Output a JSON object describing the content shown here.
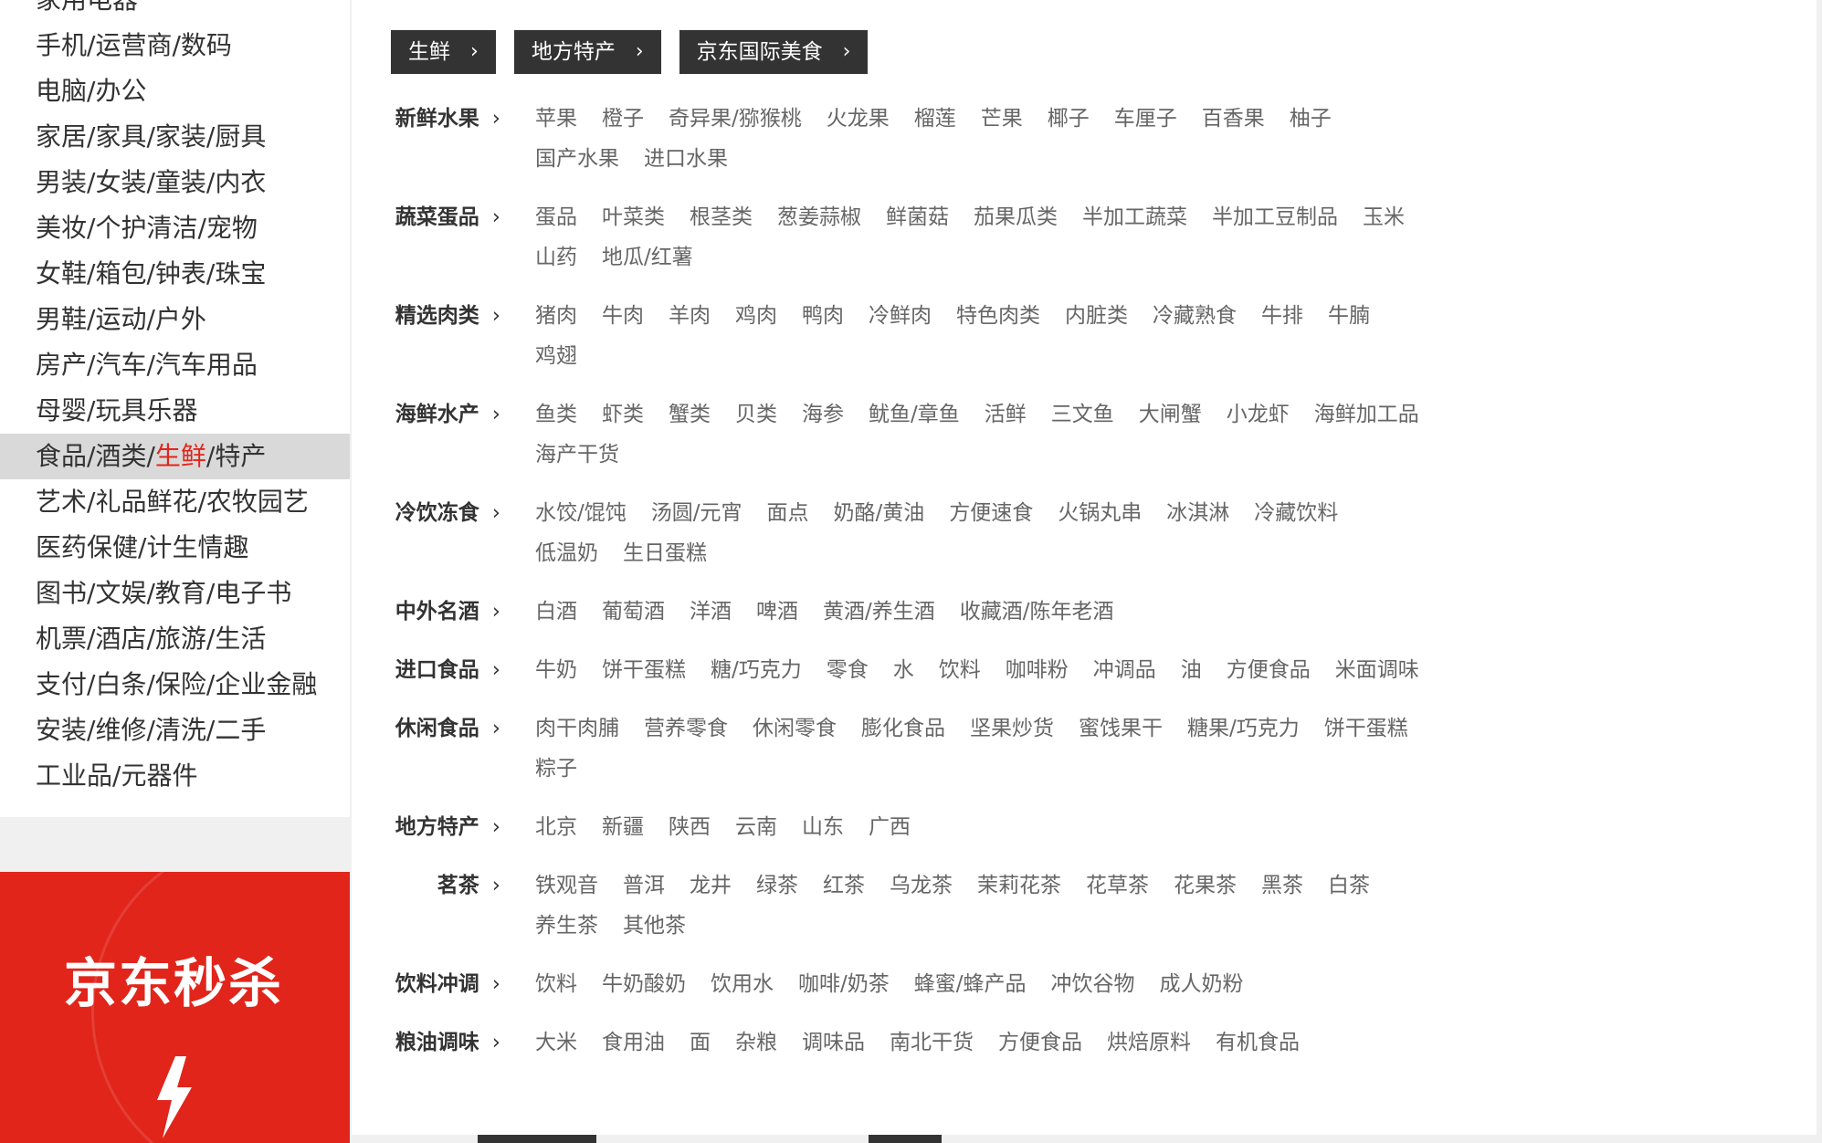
{
  "sidebar": {
    "items": [
      {
        "parts": [
          "家用电器"
        ]
      },
      {
        "parts": [
          "手机",
          "运营商",
          "数码"
        ]
      },
      {
        "parts": [
          "电脑",
          "办公"
        ]
      },
      {
        "parts": [
          "家居",
          "家具",
          "家装",
          "厨具"
        ]
      },
      {
        "parts": [
          "男装",
          "女装",
          "童装",
          "内衣"
        ]
      },
      {
        "parts": [
          "美妆",
          "个护清洁",
          "宠物"
        ]
      },
      {
        "parts": [
          "女鞋",
          "箱包",
          "钟表",
          "珠宝"
        ]
      },
      {
        "parts": [
          "男鞋",
          "运动",
          "户外"
        ]
      },
      {
        "parts": [
          "房产",
          "汽车",
          "汽车用品"
        ]
      },
      {
        "parts": [
          "母婴",
          "玩具乐器"
        ]
      },
      {
        "parts": [
          "食品",
          "酒类",
          "生鲜",
          "特产"
        ],
        "active": true,
        "highlight": 2
      },
      {
        "parts": [
          "艺术",
          "礼品鲜花",
          "农牧园艺"
        ]
      },
      {
        "parts": [
          "医药保健",
          "计生情趣"
        ]
      },
      {
        "parts": [
          "图书",
          "文娱",
          "教育",
          "电子书"
        ]
      },
      {
        "parts": [
          "机票",
          "酒店",
          "旅游",
          "生活"
        ]
      },
      {
        "parts": [
          "支付",
          "白条",
          "保险",
          "企业金融"
        ]
      },
      {
        "parts": [
          "安装",
          "维修",
          "清洗",
          "二手"
        ]
      },
      {
        "parts": [
          "工业品",
          "元器件"
        ]
      }
    ],
    "separator": "/"
  },
  "seckill": {
    "title": "京东秒杀"
  },
  "tabs": [
    {
      "label": "生鲜",
      "chevron": "›"
    },
    {
      "label": "地方特产",
      "chevron": "›"
    },
    {
      "label": "京东国际美食",
      "chevron": "›"
    }
  ],
  "rows": [
    {
      "label": "新鲜水果",
      "items": [
        "苹果",
        "橙子",
        "奇异果/猕猴桃",
        "火龙果",
        "榴莲",
        "芒果",
        "椰子",
        "车厘子",
        "百香果",
        "柚子",
        "国产水果",
        "进口水果"
      ]
    },
    {
      "label": "蔬菜蛋品",
      "items": [
        "蛋品",
        "叶菜类",
        "根茎类",
        "葱姜蒜椒",
        "鲜菌菇",
        "茄果瓜类",
        "半加工蔬菜",
        "半加工豆制品",
        "玉米",
        "山药",
        "地瓜/红薯"
      ]
    },
    {
      "label": "精选肉类",
      "items": [
        "猪肉",
        "牛肉",
        "羊肉",
        "鸡肉",
        "鸭肉",
        "冷鲜肉",
        "特色肉类",
        "内脏类",
        "冷藏熟食",
        "牛排",
        "牛腩",
        "鸡翅"
      ]
    },
    {
      "label": "海鲜水产",
      "items": [
        "鱼类",
        "虾类",
        "蟹类",
        "贝类",
        "海参",
        "鱿鱼/章鱼",
        "活鲜",
        "三文鱼",
        "大闸蟹",
        "小龙虾",
        "海鲜加工品",
        "海产干货"
      ]
    },
    {
      "label": "冷饮冻食",
      "items": [
        "水饺/馄饨",
        "汤圆/元宵",
        "面点",
        "奶酪/黄油",
        "方便速食",
        "火锅丸串",
        "冰淇淋",
        "冷藏饮料",
        "低温奶",
        "生日蛋糕"
      ]
    },
    {
      "label": "中外名酒",
      "items": [
        "白酒",
        "葡萄酒",
        "洋酒",
        "啤酒",
        "黄酒/养生酒",
        "收藏酒/陈年老酒"
      ]
    },
    {
      "label": "进口食品",
      "items": [
        "牛奶",
        "饼干蛋糕",
        "糖/巧克力",
        "零食",
        "水",
        "饮料",
        "咖啡粉",
        "冲调品",
        "油",
        "方便食品",
        "米面调味"
      ]
    },
    {
      "label": "休闲食品",
      "items": [
        "肉干肉脯",
        "营养零食",
        "休闲零食",
        "膨化食品",
        "坚果炒货",
        "蜜饯果干",
        "糖果/巧克力",
        "饼干蛋糕",
        "粽子"
      ]
    },
    {
      "label": "地方特产",
      "items": [
        "北京",
        "新疆",
        "陕西",
        "云南",
        "山东",
        "广西"
      ]
    },
    {
      "label": "茗茶",
      "items": [
        "铁观音",
        "普洱",
        "龙井",
        "绿茶",
        "红茶",
        "乌龙茶",
        "茉莉花茶",
        "花草茶",
        "花果茶",
        "黑茶",
        "白茶",
        "养生茶",
        "其他茶"
      ]
    },
    {
      "label": "饮料冲调",
      "items": [
        "饮料",
        "牛奶酸奶",
        "饮用水",
        "咖啡/奶茶",
        "蜂蜜/蜂产品",
        "冲饮谷物",
        "成人奶粉"
      ]
    },
    {
      "label": "粮油调味",
      "items": [
        "大米",
        "食用油",
        "面",
        "杂粮",
        "调味品",
        "南北干货",
        "方便食品",
        "烘焙原料",
        "有机食品"
      ]
    }
  ],
  "row_arrow": "›",
  "colors": {
    "accent": "#e1251b",
    "tab_bg": "#333333"
  }
}
